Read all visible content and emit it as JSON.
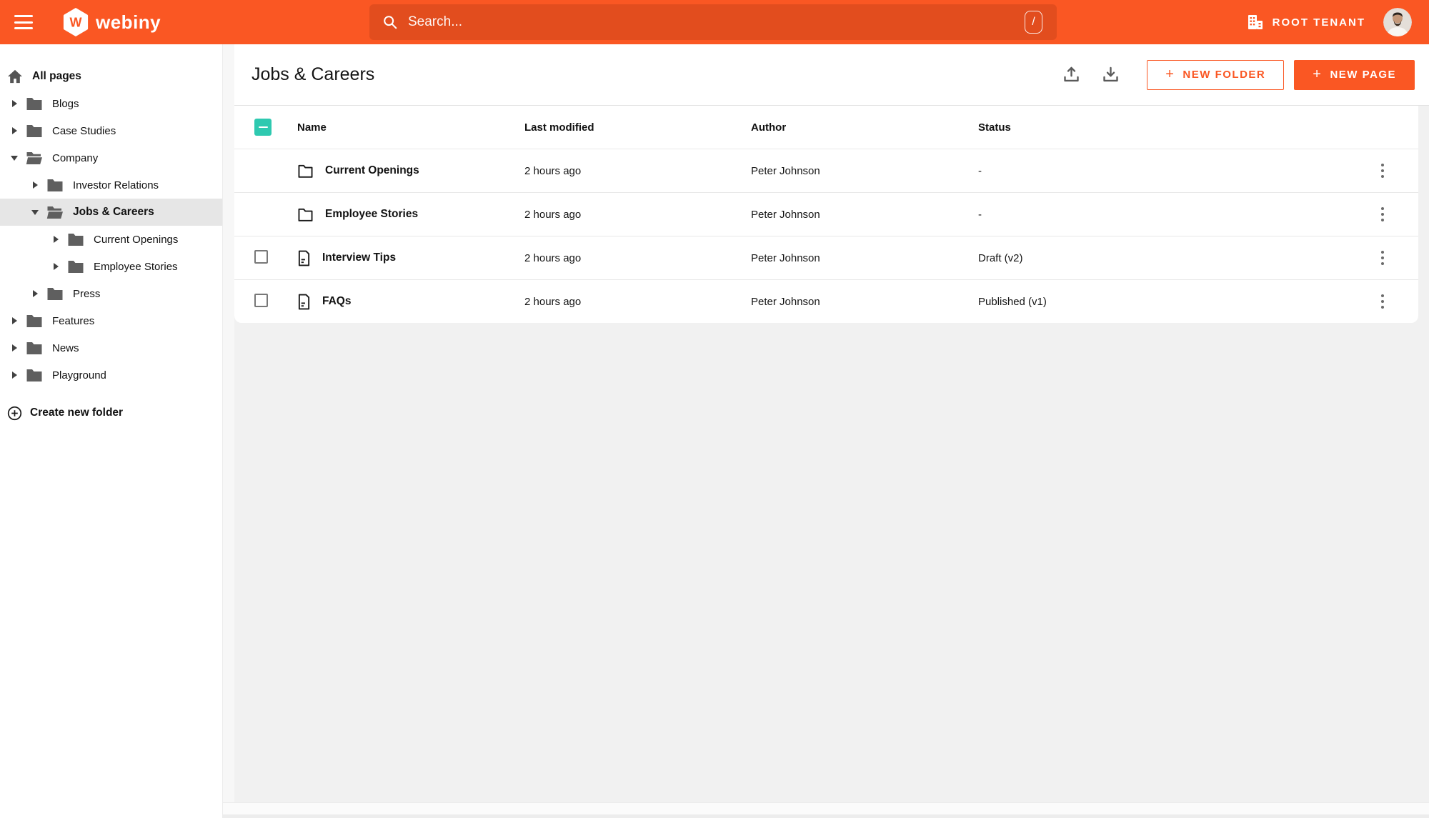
{
  "appbar": {
    "brand": "webiny",
    "brand_initial": "W",
    "search": {
      "placeholder": "Search...",
      "shortcut": "/"
    },
    "tenant": "ROOT TENANT"
  },
  "sidebar": {
    "items": [
      {
        "label": "All pages",
        "level": 0,
        "icon": "home",
        "state": "none",
        "selected": false
      },
      {
        "label": "Blogs",
        "level": 1,
        "icon": "folder",
        "state": "collapsed",
        "selected": false
      },
      {
        "label": "Case Studies",
        "level": 1,
        "icon": "folder",
        "state": "collapsed",
        "selected": false
      },
      {
        "label": "Company",
        "level": 1,
        "icon": "folder-open",
        "state": "expanded",
        "selected": false
      },
      {
        "label": "Investor Relations",
        "level": 2,
        "icon": "folder",
        "state": "collapsed",
        "selected": false
      },
      {
        "label": "Jobs & Careers",
        "level": 2,
        "icon": "folder-open",
        "state": "expanded",
        "selected": true
      },
      {
        "label": "Current Openings",
        "level": 3,
        "icon": "folder",
        "state": "collapsed",
        "selected": false
      },
      {
        "label": "Employee Stories",
        "level": 3,
        "icon": "folder",
        "state": "collapsed",
        "selected": false
      },
      {
        "label": "Press",
        "level": 2,
        "icon": "folder",
        "state": "collapsed",
        "selected": false
      },
      {
        "label": "Features",
        "level": 1,
        "icon": "folder",
        "state": "collapsed",
        "selected": false
      },
      {
        "label": "News",
        "level": 1,
        "icon": "folder",
        "state": "collapsed",
        "selected": false
      },
      {
        "label": "Playground",
        "level": 1,
        "icon": "folder",
        "state": "collapsed",
        "selected": false
      }
    ],
    "create_folder_label": "Create new folder"
  },
  "main": {
    "title": "Jobs & Careers",
    "buttons": {
      "plus": "+",
      "new_folder": "NEW FOLDER",
      "new_page": "NEW PAGE"
    },
    "table": {
      "headers": {
        "name": "Name",
        "modified": "Last modified",
        "author": "Author",
        "status": "Status"
      },
      "header_checkbox_state": "indeterminate",
      "rows": [
        {
          "type": "folder",
          "name": "Current Openings",
          "modified": "2 hours ago",
          "author": "Peter Johnson",
          "status": "-",
          "checkbox": false
        },
        {
          "type": "folder",
          "name": "Employee Stories",
          "modified": "2 hours ago",
          "author": "Peter Johnson",
          "status": "-",
          "checkbox": false
        },
        {
          "type": "page",
          "name": "Interview Tips",
          "modified": "2 hours ago",
          "author": "Peter Johnson",
          "status": "Draft (v2)",
          "checkbox": true
        },
        {
          "type": "page",
          "name": "FAQs",
          "modified": "2 hours ago",
          "author": "Peter Johnson",
          "status": "Published (v1)",
          "checkbox": true
        }
      ]
    }
  },
  "icons": {
    "hamburger": "menu",
    "search": "magnifier",
    "slash_shortcut": "/",
    "tenant_building": "building",
    "upload": "arrow-up-tray",
    "download": "arrow-down-tray",
    "row_actions": "kebab-vertical-dots"
  },
  "colors": {
    "accent_orange": "#fa5723",
    "search_field_orange": "#e24d1e",
    "teal_checkbox": "#2ec9b0",
    "selected_sidebar_bg": "#e6e6e6",
    "content_bg": "#f1f1f1"
  }
}
